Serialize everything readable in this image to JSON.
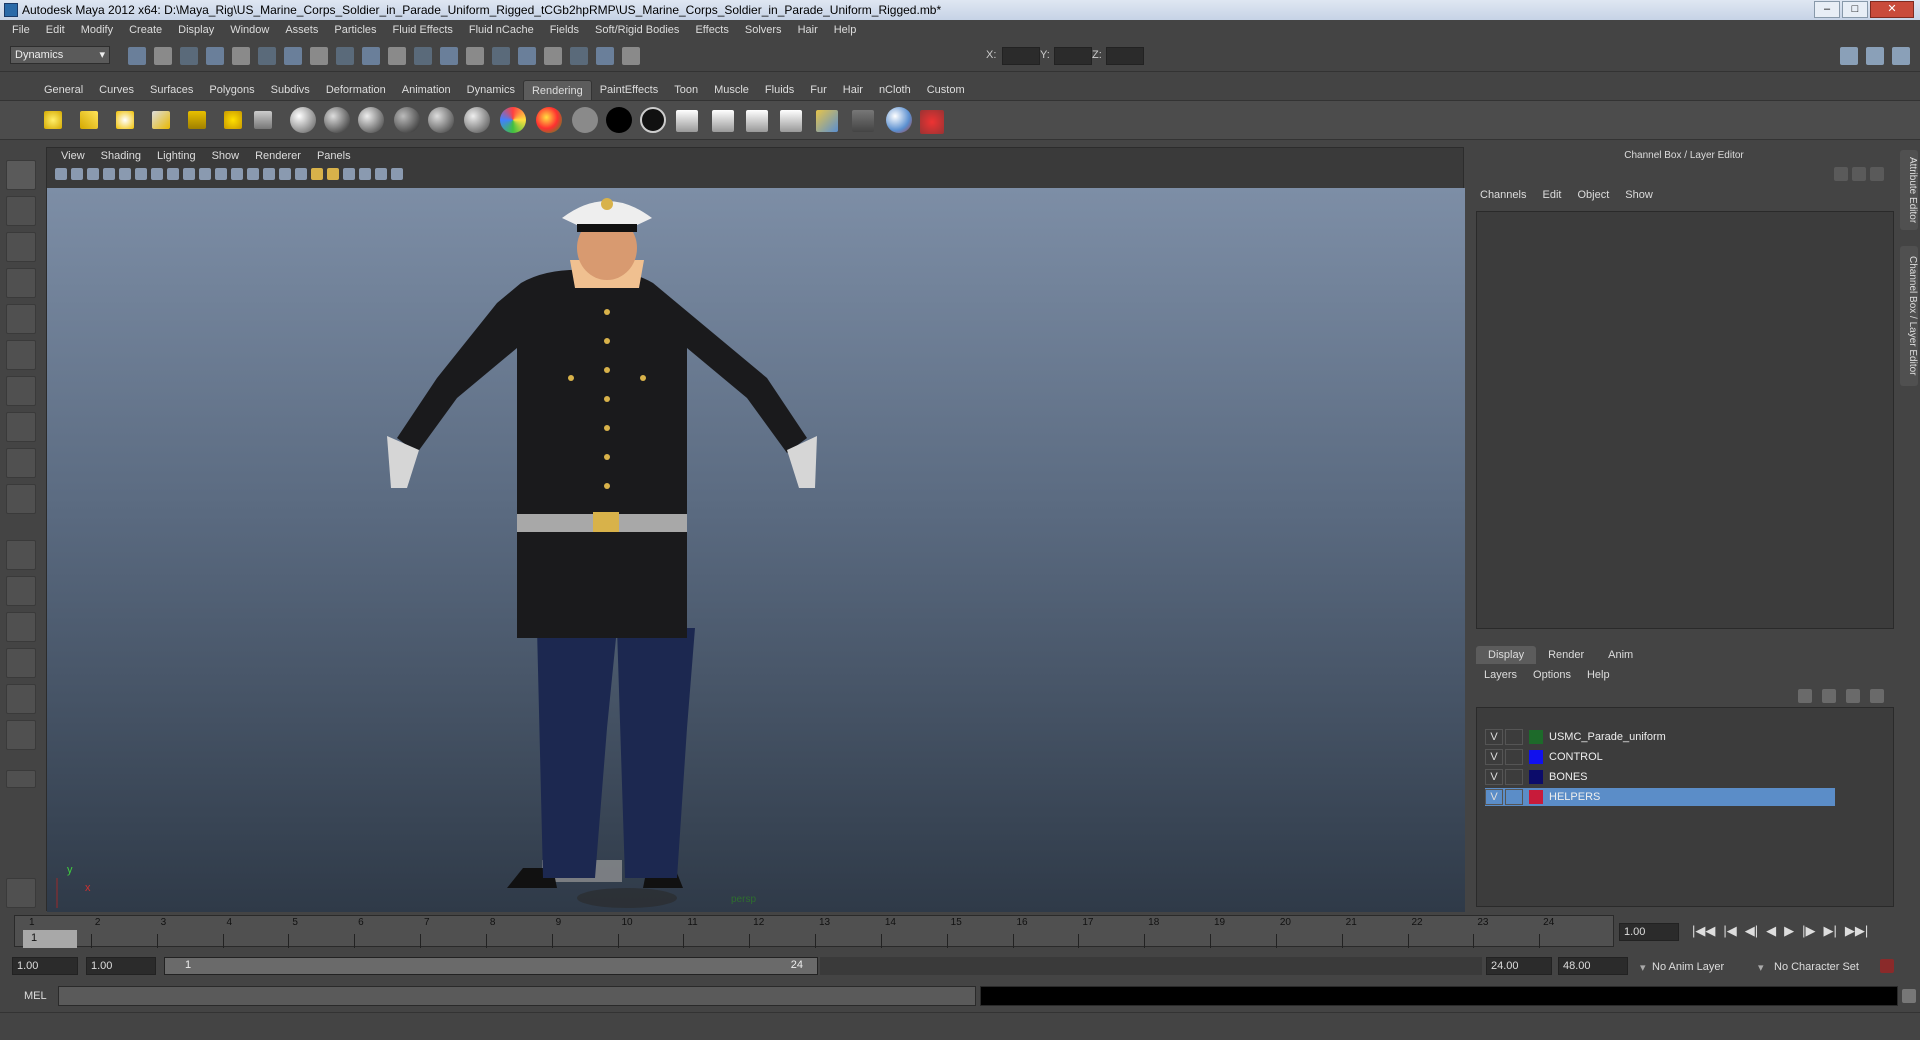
{
  "window": {
    "title": "Autodesk Maya 2012 x64: D:\\Maya_Rig\\US_Marine_Corps_Soldier_in_Parade_Uniform_Rigged_tCGb2hpRMP\\US_Marine_Corps_Soldier_in_Parade_Uniform_Rigged.mb*",
    "minimize": "–",
    "maximize": "□",
    "close": "✕"
  },
  "menubar": [
    "File",
    "Edit",
    "Modify",
    "Create",
    "Display",
    "Window",
    "Assets",
    "Particles",
    "Fluid Effects",
    "Fluid nCache",
    "Fields",
    "Soft/Rigid Bodies",
    "Effects",
    "Solvers",
    "Hair",
    "Help"
  ],
  "statusline": {
    "mode": "Dynamics",
    "x_label": "X:",
    "y_label": "Y:",
    "z_label": "Z:"
  },
  "shelf_tabs": [
    "General",
    "Curves",
    "Surfaces",
    "Polygons",
    "Subdivs",
    "Deformation",
    "Animation",
    "Dynamics",
    "Rendering",
    "PaintEffects",
    "Toon",
    "Muscle",
    "Fluids",
    "Fur",
    "Hair",
    "nCloth",
    "Custom"
  ],
  "shelf_active": "Rendering",
  "viewport": {
    "menu": [
      "View",
      "Shading",
      "Lighting",
      "Show",
      "Renderer",
      "Panels"
    ],
    "camera": "persp",
    "axis_y": "y",
    "axis_x": "x"
  },
  "channel_box": {
    "title": "Channel Box / Layer Editor",
    "menu": [
      "Channels",
      "Edit",
      "Object",
      "Show"
    ]
  },
  "layer_editor": {
    "tabs": [
      "Display",
      "Render",
      "Anim"
    ],
    "active_tab": "Display",
    "menu": [
      "Layers",
      "Options",
      "Help"
    ],
    "layers": [
      {
        "v": "V",
        "name": "USMC_Parade_uniform",
        "color": "#1d6a2a",
        "selected": false
      },
      {
        "v": "V",
        "name": "CONTROL",
        "color": "#1010ee",
        "selected": false
      },
      {
        "v": "V",
        "name": "BONES",
        "color": "#0c0c6a",
        "selected": false
      },
      {
        "v": "V",
        "name": "HELPERS",
        "color": "#c81b3a",
        "selected": true
      }
    ]
  },
  "side_tabs": [
    "Attribute Editor",
    "Channel Box / Layer Editor"
  ],
  "timeline": {
    "ticks": [
      "1",
      "2",
      "3",
      "4",
      "5",
      "6",
      "7",
      "8",
      "9",
      "10",
      "11",
      "12",
      "13",
      "14",
      "15",
      "16",
      "17",
      "18",
      "19",
      "20",
      "21",
      "22",
      "23",
      "24"
    ],
    "current_frame_marker": "1",
    "current_frame": "1.00"
  },
  "playback": [
    "|◀◀",
    "|◀",
    "◀|",
    "◀",
    "▶",
    "|▶",
    "▶|",
    "▶▶|"
  ],
  "range": {
    "start": "1.00",
    "anim_start": "1.00",
    "slider_start": "1",
    "slider_end": "24",
    "anim_end": "24.00",
    "end": "48.00",
    "anim_layer": "No Anim Layer",
    "char_set": "No Character Set"
  },
  "command": {
    "label": "MEL"
  }
}
